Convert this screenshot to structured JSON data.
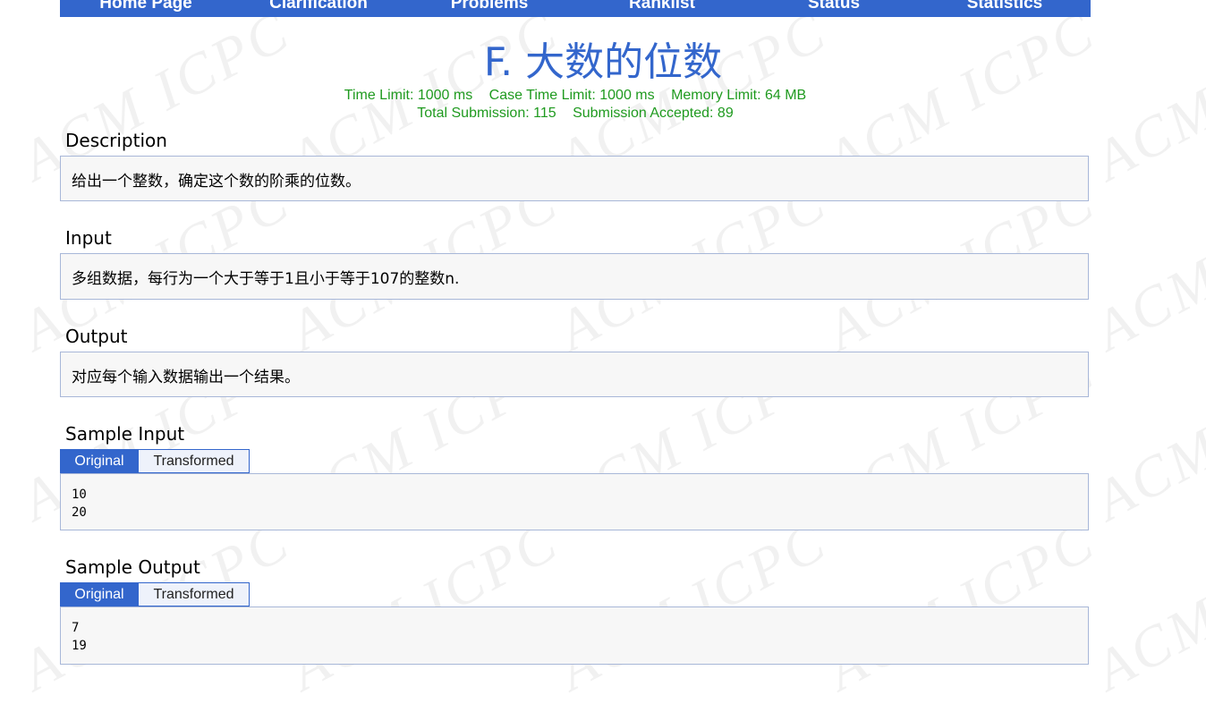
{
  "nav": {
    "items": [
      "Home Page",
      "Clarification",
      "Problems",
      "Ranklist",
      "Status",
      "Statistics"
    ]
  },
  "problem": {
    "title": "F. 大数的位数",
    "time_limit": "Time Limit: 1000 ms",
    "case_time_limit": "Case Time Limit: 1000 ms",
    "memory_limit": "Memory Limit: 64 MB",
    "total_submission": "Total Submission: 115",
    "accepted": "Submission Accepted: 89"
  },
  "sections": {
    "description": {
      "heading": "Description",
      "text": "给出一个整数，确定这个数的阶乘的位数。"
    },
    "input": {
      "heading": "Input",
      "text": "多组数据，每行为一个大于等于1且小于等于107的整数n."
    },
    "output": {
      "heading": "Output",
      "text": "对应每个输入数据输出一个结果。"
    },
    "sample_input": {
      "heading": "Sample Input",
      "tab_original": "Original",
      "tab_transformed": "Transformed",
      "lines": [
        "10",
        "20"
      ]
    },
    "sample_output": {
      "heading": "Sample Output",
      "tab_original": "Original",
      "tab_transformed": "Transformed",
      "lines": [
        "7",
        "19"
      ]
    }
  },
  "watermark": {
    "acm": "ACM",
    "icpc": "ICPC"
  },
  "colors": {
    "accent": "#3366cc",
    "limits": "#1f9a1f",
    "box_bg": "#f7f7f7",
    "box_border": "#a8b7d8"
  }
}
